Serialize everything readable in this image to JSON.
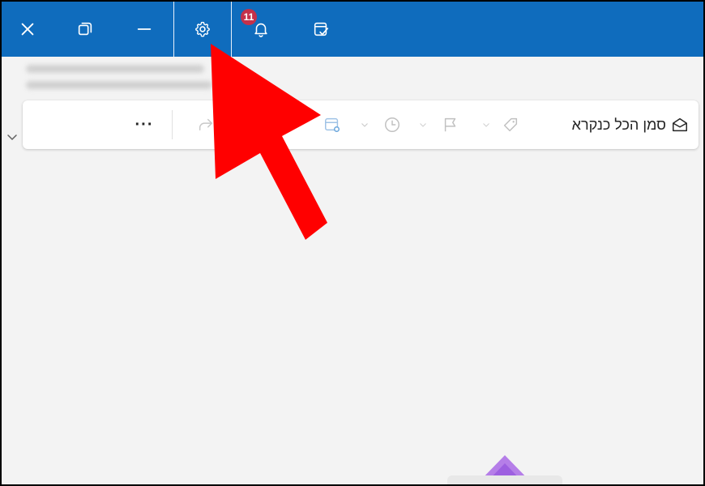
{
  "titlebar": {
    "background": "#0f6cbd",
    "buttons": [
      {
        "name": "close-icon"
      },
      {
        "name": "restore-icon"
      },
      {
        "name": "minimize-icon"
      },
      {
        "name": "gear-icon"
      },
      {
        "name": "bell-icon",
        "badge": "11"
      },
      {
        "name": "calendar-check-icon"
      }
    ]
  },
  "toolbar": {
    "mark_all_read_label": "סמן הכל כנקרא",
    "more_label": "···",
    "icons": [
      "envelope-open-icon",
      "tag-icon",
      "flag-icon",
      "clock-icon",
      "calendar-settings-icon",
      "forward-icon"
    ]
  },
  "colors": {
    "accent": "#0f6cbd",
    "badge": "#c4314b",
    "arrow": "#ff0000"
  }
}
